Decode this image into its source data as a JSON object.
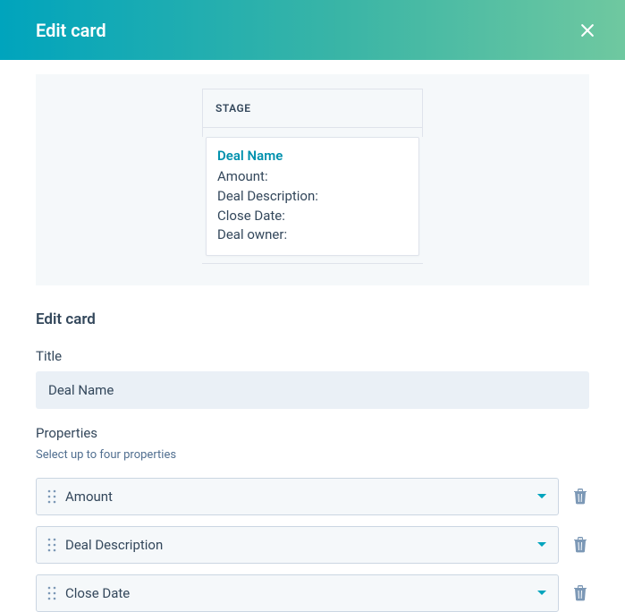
{
  "header": {
    "title": "Edit card"
  },
  "preview": {
    "stage_label": "STAGE",
    "card_title": "Deal Name",
    "lines": [
      "Amount:",
      "Deal Description:",
      "Close Date:",
      "Deal owner:"
    ]
  },
  "section_heading": "Edit card",
  "title_field": {
    "label": "Title",
    "value": "Deal Name"
  },
  "properties": {
    "label": "Properties",
    "hint": "Select up to four properties",
    "items": [
      "Amount",
      "Deal Description",
      "Close Date"
    ]
  }
}
